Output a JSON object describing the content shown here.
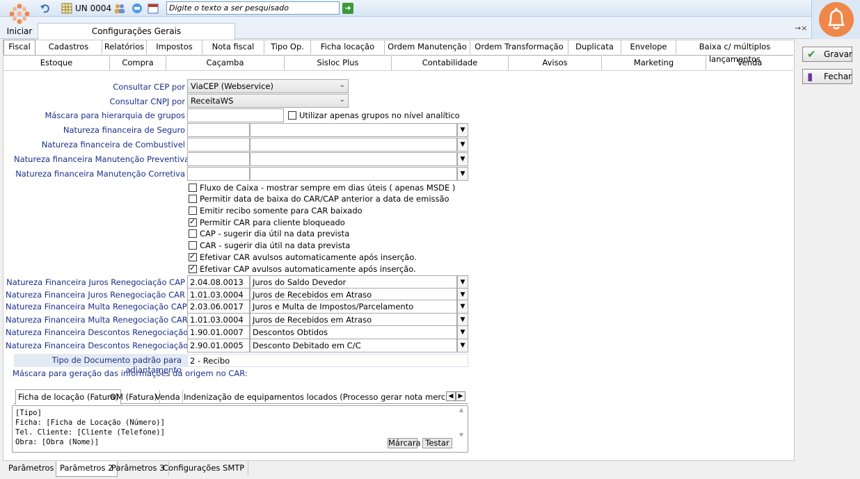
{
  "toolbar": {
    "start_label": "Iniciar",
    "unit_label": "UN 0004",
    "search_placeholder": "Digite o texto a ser pesquisado"
  },
  "window_tab": {
    "title": "Configurações Gerais",
    "pin_close": "→×"
  },
  "tabs_row1": [
    "Fiscal",
    "Cadastros",
    "Relatórios",
    "Impostos",
    "Nota fiscal",
    "Tipo Op.",
    "Ficha locação",
    "Ordem Manutenção",
    "Ordem Transformação",
    "Duplicata",
    "Envelope",
    "Baixa c/ múltiplos lançamentos"
  ],
  "tabs_row2": [
    "Estoque",
    "Compra",
    "Caçamba",
    "Sisloc Plus",
    "Contabilidade",
    "Avisos",
    "Marketing",
    "Venda"
  ],
  "form": {
    "cep_label": "Consultar CEP por",
    "cep_value": "ViaCEP (Webservice)",
    "cnpj_label": "Consultar CNPJ por",
    "cnpj_value": "ReceitaWS",
    "mask_group_label": "Máscara para hierarquia de grupos",
    "analytic_only_label": "Utilizar apenas grupos no nível analítico",
    "nat_seguro": "Natureza financeira de Seguro",
    "nat_combustivel": "Natureza financeira de Combustível",
    "nat_manut_prev": "Natureza financeira Manutenção Preventiva",
    "nat_manut_corr": "Natureza financeira Manutenção Corretiva"
  },
  "checkboxes": [
    {
      "label": "Fluxo de Caixa - mostrar sempre em dias úteis ( apenas MSDE )",
      "checked": false
    },
    {
      "label": "Permitir data de baixa do CAR/CAP anterior a data de emissão",
      "checked": false
    },
    {
      "label": "Emitir recibo somente para CAR baixado",
      "checked": false
    },
    {
      "label": "Permitir CAR para cliente bloqueado",
      "checked": true
    },
    {
      "label": "CAP - sugerir dia útil na data prevista",
      "checked": false
    },
    {
      "label": "CAR - sugerir dia útil na data prevista",
      "checked": false
    },
    {
      "label": "Efetivar CAR avulsos automaticamente após inserção.",
      "checked": true
    },
    {
      "label": "Efetivar CAP avulsos automaticamente após inserção.",
      "checked": true
    }
  ],
  "renegotiation": [
    {
      "label": "Natureza Financeira Juros Renegociação CAP",
      "code": "2.04.08.0013",
      "desc": "Juros do Saldo Devedor"
    },
    {
      "label": "Natureza Financeira Juros Renegociação CAR",
      "code": "1.01.03.0004",
      "desc": "Juros de Recebidos em Atraso"
    },
    {
      "label": "Natureza Financeira Multa Renegociação CAP",
      "code": "2.03.06.0017",
      "desc": "Juros e Multa de Impostos/Parcelamento"
    },
    {
      "label": "Natureza Financeira Multa Renegociação CAR",
      "code": "1.01.03.0004",
      "desc": "Juros de Recebidos em Atraso"
    },
    {
      "label": "Natureza Financeira Descontos Renegociação CAP",
      "code": "1.90.01.0007",
      "desc": "Descontos Obtidos"
    },
    {
      "label": "Natureza Financeira Descontos Renegociação CAR",
      "code": "2.90.01.0005",
      "desc": "Desconto Debitado em C/C"
    }
  ],
  "tipo_doc": {
    "label": "Tipo de Documento padrão para adiantamento",
    "value": "2 - Recibo"
  },
  "mask_origin_label": "Máscara para geração das informações da origem no CAR:",
  "subtabs": [
    "Ficha de locação (Fatura)",
    "OM (Fatura)",
    "Venda",
    "Indenização de equipamentos locados (Processo gerar nota mercadoria e serv"
  ],
  "memo": {
    "lines": [
      "[Tipo]",
      "Ficha: [Ficha de Locação (Número)]",
      "Tel. Cliente: [Cliente (Telefone)]",
      "Obra: [Obra (Nome)]"
    ],
    "btn_mascara": "Márcara",
    "btn_testar": "Testar"
  },
  "bottom_tabs": [
    "Parâmetros 1",
    "Parâmetros 2",
    "Parâmetros 3",
    "Configurações SMTP"
  ],
  "buttons": {
    "save": "Gravar",
    "close": "Fechar"
  },
  "colors": {
    "label_blue": "#1a2e8a",
    "bell_orange": "#f0874a",
    "save_green": "#2e9b2e"
  }
}
